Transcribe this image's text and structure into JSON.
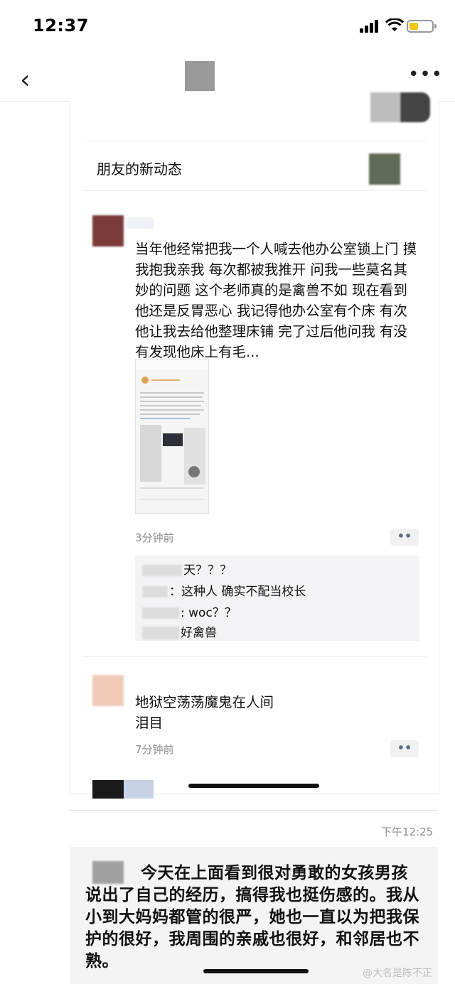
{
  "status": {
    "time": "12:37"
  },
  "nav": {
    "back_glyph": "‹",
    "more_glyph": "•••"
  },
  "friends": {
    "label": "朋友的新动态"
  },
  "post": {
    "text": "当年他经常把我一个人喊去他办公室锁上门 摸我抱我亲我 每次都被我推开 问我一些莫名其妙的问题 这个老师真的是禽兽不如 现在看到他还是反胃恶心 我记得他办公室有个床 有次他让我去给他整理床铺 完了过后他问我 有没有发现他床上有毛...",
    "time": "3分钟前",
    "more_glyph": "••",
    "comments": [
      {
        "text": "天？？？"
      },
      {
        "text": "：这种人 确实不配当校长"
      },
      {
        "text": ": woc？？"
      },
      {
        "text": "好禽兽"
      }
    ]
  },
  "reply": {
    "line1": "地狱空荡荡魔鬼在人间",
    "line2": "泪目",
    "time": "7分钟前",
    "more_glyph": "••"
  },
  "timestamp": "下午12:25",
  "letter": {
    "text": "今天在上面看到很对勇敢的女孩男孩说出了自己的经历，搞得我也挺伤感的。我从小到大妈妈都管的很严，她也一直以为把我保护的很好，我周围的亲戚也很好，和邻居也不熟。"
  },
  "watermark": "@大名是陈不正",
  "colors": {
    "battery": "#f3c61a",
    "link_blue": "#5a6b8a"
  }
}
